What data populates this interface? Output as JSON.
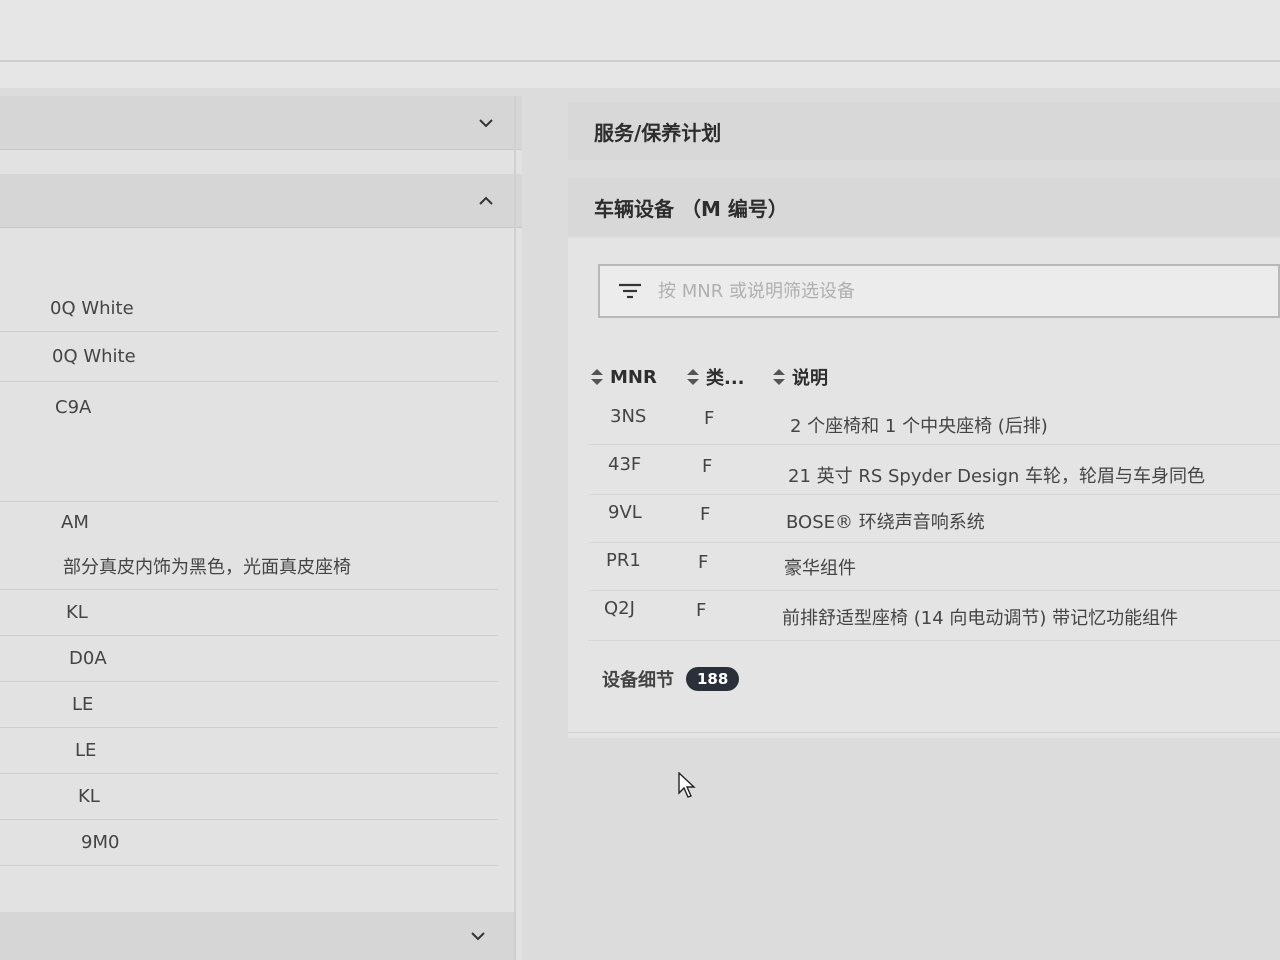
{
  "left": {
    "rows": [
      {
        "text": "0Q White"
      },
      {
        "text": "0Q White"
      },
      {
        "text": "C9A"
      },
      {
        "text": ""
      },
      {
        "text": "AM"
      },
      {
        "text": "部分真皮内饰为黑色，光面真皮座椅"
      },
      {
        "text": "KL"
      },
      {
        "text": "D0A"
      },
      {
        "text": "LE"
      },
      {
        "text": "LE"
      },
      {
        "text": "KL"
      },
      {
        "text": "9M0"
      }
    ]
  },
  "right": {
    "service_plan_title": "服务/保养计划",
    "equipment_title": "车辆设备 （M 编号）",
    "filter_placeholder": "按 MNR 或说明筛选设备",
    "columns": {
      "mnr": "MNR",
      "type": "类...",
      "desc": "说明"
    },
    "equipment": [
      {
        "mnr": "3NS",
        "type": "F",
        "desc": "2 个座椅和 1 个中央座椅 (后排)"
      },
      {
        "mnr": "43F",
        "type": "F",
        "desc": "21 英寸 RS Spyder Design 车轮，轮眉与车身同色"
      },
      {
        "mnr": "9VL",
        "type": "F",
        "desc": "BOSE® 环绕声音响系统"
      },
      {
        "mnr": "PR1",
        "type": "F",
        "desc": "豪华组件"
      },
      {
        "mnr": "Q2J",
        "type": "F",
        "desc": "前排舒适型座椅 (14 向电动调节) 带记忆功能组件"
      }
    ],
    "details_label": "设备细节",
    "details_count": "188"
  },
  "icons": {
    "collapse": "chevron-down-icon",
    "expand": "chevron-up-icon",
    "filter": "filter-icon",
    "sort": "sort-icon",
    "cursor": "mouse-pointer-icon"
  },
  "colors": {
    "badge_bg": "#2b2f3a",
    "header_bg": "#d8d8d8"
  }
}
